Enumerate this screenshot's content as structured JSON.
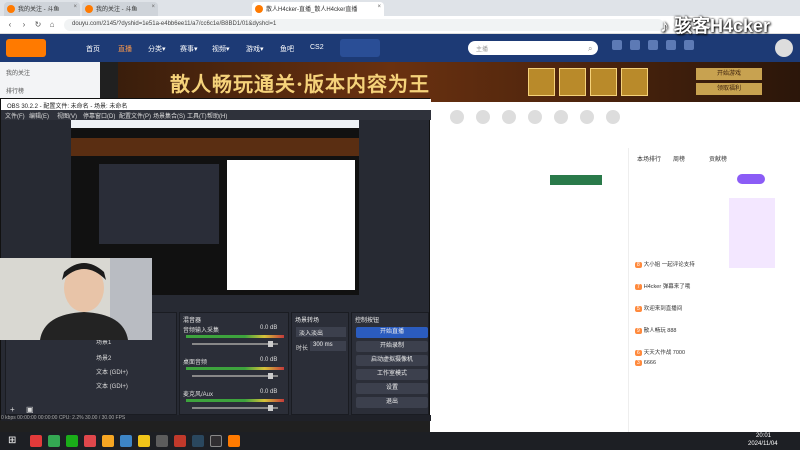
{
  "browser": {
    "tabs": [
      {
        "label": "我的关注 - 斗鱼",
        "active": false
      },
      {
        "label": "我的关注 - 斗鱼",
        "active": false
      },
      {
        "label": "散人H4cker-直播_散人H4cker直播",
        "active": true
      }
    ],
    "url": "douyu.com/2145/?dyshid=1e51a-e4bb6ee11/a7/cc6c1e/B8BD1/01&dyshcl=1"
  },
  "douyu_header": {
    "nav": [
      "首页",
      "直播",
      "分类▾",
      "赛事▾",
      "视频▾",
      "游戏▾",
      "鱼吧",
      "CS2"
    ],
    "search_placeholder": "主播"
  },
  "douyu_sidebar": {
    "items": [
      "我的关注",
      "排行榜"
    ]
  },
  "banner": {
    "title": "散人畅玩通关·版本内容为王",
    "btn1": "开始游戏",
    "btn2": "领取福利"
  },
  "tiktok_watermark": "骇客H4cker",
  "obs": {
    "title": "OBS 30.2.2 - 配置文件: 未命名 - 场景: 未命名",
    "menu": [
      "文件(F)",
      "编辑(E)",
      "视图(V)",
      "停靠窗口(D)",
      "配置文件(P)",
      "场景集合(S)",
      "工具(T)",
      "帮助(H)"
    ],
    "mixer_header": "混音器",
    "mixer_items": [
      {
        "name": "音频输入采集",
        "db": "0.0 dB"
      },
      {
        "name": "桌面音频",
        "db": "0.0 dB"
      },
      {
        "name": "麦克风/Aux",
        "db": "0.0 dB"
      }
    ],
    "transitions_header": "场景转场",
    "transition_value": "淡入淡出",
    "duration_label": "时长",
    "duration_value": "300 ms",
    "controls_header": "控制按钮",
    "controls": [
      "开始直播",
      "开始录制",
      "启动虚拟摄像机",
      "工作室模式",
      "设置",
      "退出"
    ],
    "scenes": [
      "场景1",
      "场景2",
      "文本 (GDI+)",
      "文本 (GDI+)"
    ],
    "status": "0 kbps   00:00:00   00:00:00   CPU: 2.2%   30.00 / 30.00 FPS"
  },
  "right_panel": {
    "tabs": [
      "本场排行",
      "周榜",
      "贡献榜"
    ],
    "chat": [
      "大小姐 一起评论支持",
      "H4cker 弹幕来了哦",
      "欢迎来到直播间",
      "散人畅玩 888",
      "天天大作战 7000",
      "6666"
    ]
  },
  "taskbar": {
    "time": "20:01",
    "date": "2024/11/04"
  }
}
